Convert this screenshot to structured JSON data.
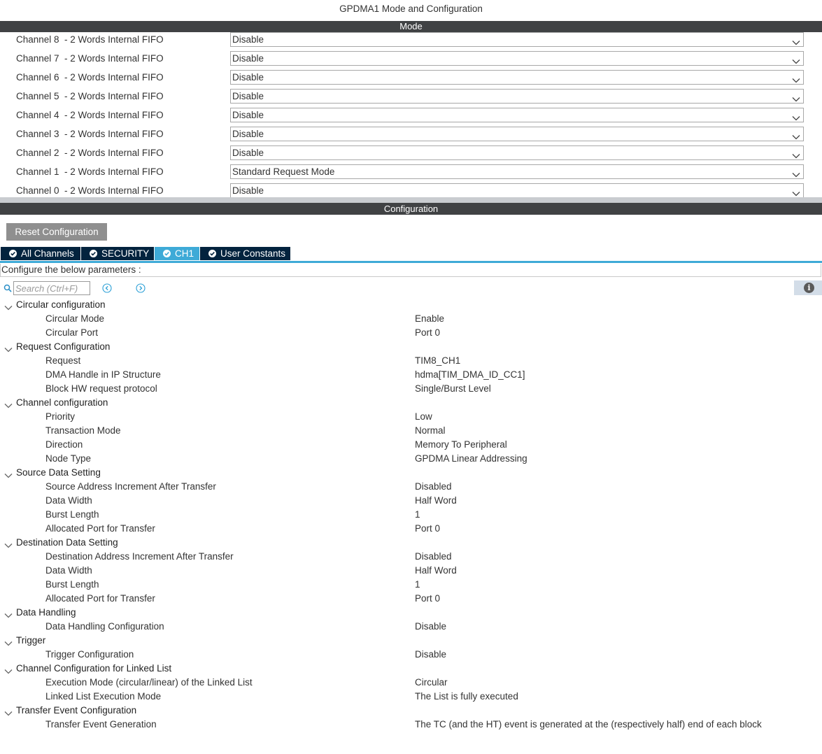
{
  "window": {
    "title": "GPDMA1 Mode and Configuration"
  },
  "mode": {
    "header": "Mode",
    "rows": [
      {
        "label": "Channel 8  - 2 Words Internal FIFO",
        "value": "Disable"
      },
      {
        "label": "Channel 7  - 2 Words Internal FIFO",
        "value": "Disable"
      },
      {
        "label": "Channel 6  - 2 Words Internal FIFO",
        "value": "Disable"
      },
      {
        "label": "Channel 5  - 2 Words Internal FIFO",
        "value": "Disable"
      },
      {
        "label": "Channel 4  - 2 Words Internal FIFO",
        "value": "Disable"
      },
      {
        "label": "Channel 3  - 2 Words Internal FIFO",
        "value": "Disable"
      },
      {
        "label": "Channel 2  - 2 Words Internal FIFO",
        "value": "Disable"
      },
      {
        "label": "Channel 1  - 2 Words Internal FIFO",
        "value": "Standard Request Mode"
      },
      {
        "label": "Channel 0  - 2 Words Internal FIFO",
        "value": "Disable"
      }
    ]
  },
  "configuration": {
    "header": "Configuration",
    "reset_label": "Reset Configuration",
    "tabs": [
      {
        "label": "All Channels",
        "active": false
      },
      {
        "label": "SECURITY",
        "active": false
      },
      {
        "label": "CH1",
        "active": true
      },
      {
        "label": "User Constants",
        "active": false
      }
    ],
    "configure_text": "Configure the below parameters :",
    "search_placeholder": "Search (Ctrl+F)",
    "groups": [
      {
        "name": "Circular configuration",
        "params": [
          {
            "label": "Circular Mode",
            "value": "Enable"
          },
          {
            "label": "Circular Port",
            "value": "Port 0"
          }
        ]
      },
      {
        "name": "Request Configuration",
        "params": [
          {
            "label": "Request",
            "value": "TIM8_CH1"
          },
          {
            "label": "DMA Handle in IP Structure",
            "value": "hdma[TIM_DMA_ID_CC1]"
          },
          {
            "label": "Block HW request protocol",
            "value": "Single/Burst Level"
          }
        ]
      },
      {
        "name": "Channel configuration",
        "params": [
          {
            "label": "Priority",
            "value": "Low"
          },
          {
            "label": "Transaction Mode",
            "value": "Normal"
          },
          {
            "label": "Direction",
            "value": "Memory To Peripheral"
          },
          {
            "label": "Node Type",
            "value": "GPDMA Linear Addressing"
          }
        ]
      },
      {
        "name": "Source Data Setting",
        "params": [
          {
            "label": "Source Address Increment After Transfer",
            "value": "Disabled"
          },
          {
            "label": "Data Width",
            "value": "Half Word"
          },
          {
            "label": "Burst Length",
            "value": "1"
          },
          {
            "label": "Allocated Port for Transfer",
            "value": "Port 0"
          }
        ]
      },
      {
        "name": "Destination Data Setting",
        "params": [
          {
            "label": "Destination Address Increment After Transfer",
            "value": "Disabled"
          },
          {
            "label": "Data Width",
            "value": "Half Word"
          },
          {
            "label": "Burst Length",
            "value": "1"
          },
          {
            "label": "Allocated Port for Transfer",
            "value": "Port 0"
          }
        ]
      },
      {
        "name": "Data Handling",
        "params": [
          {
            "label": "Data Handling Configuration",
            "value": "Disable"
          }
        ]
      },
      {
        "name": "Trigger",
        "params": [
          {
            "label": "Trigger Configuration",
            "value": "Disable"
          }
        ]
      },
      {
        "name": "Channel Configuration for Linked List",
        "params": [
          {
            "label": "Execution Mode (circular/linear) of the Linked List",
            "value": "Circular"
          },
          {
            "label": "Linked List Execution Mode",
            "value": "The List is fully executed"
          }
        ]
      },
      {
        "name": "Transfer Event Configuration",
        "params": [
          {
            "label": "Transfer Event Generation",
            "value": "The TC (and the HT) event is generated at the (respectively half) end of each block"
          }
        ]
      }
    ]
  }
}
